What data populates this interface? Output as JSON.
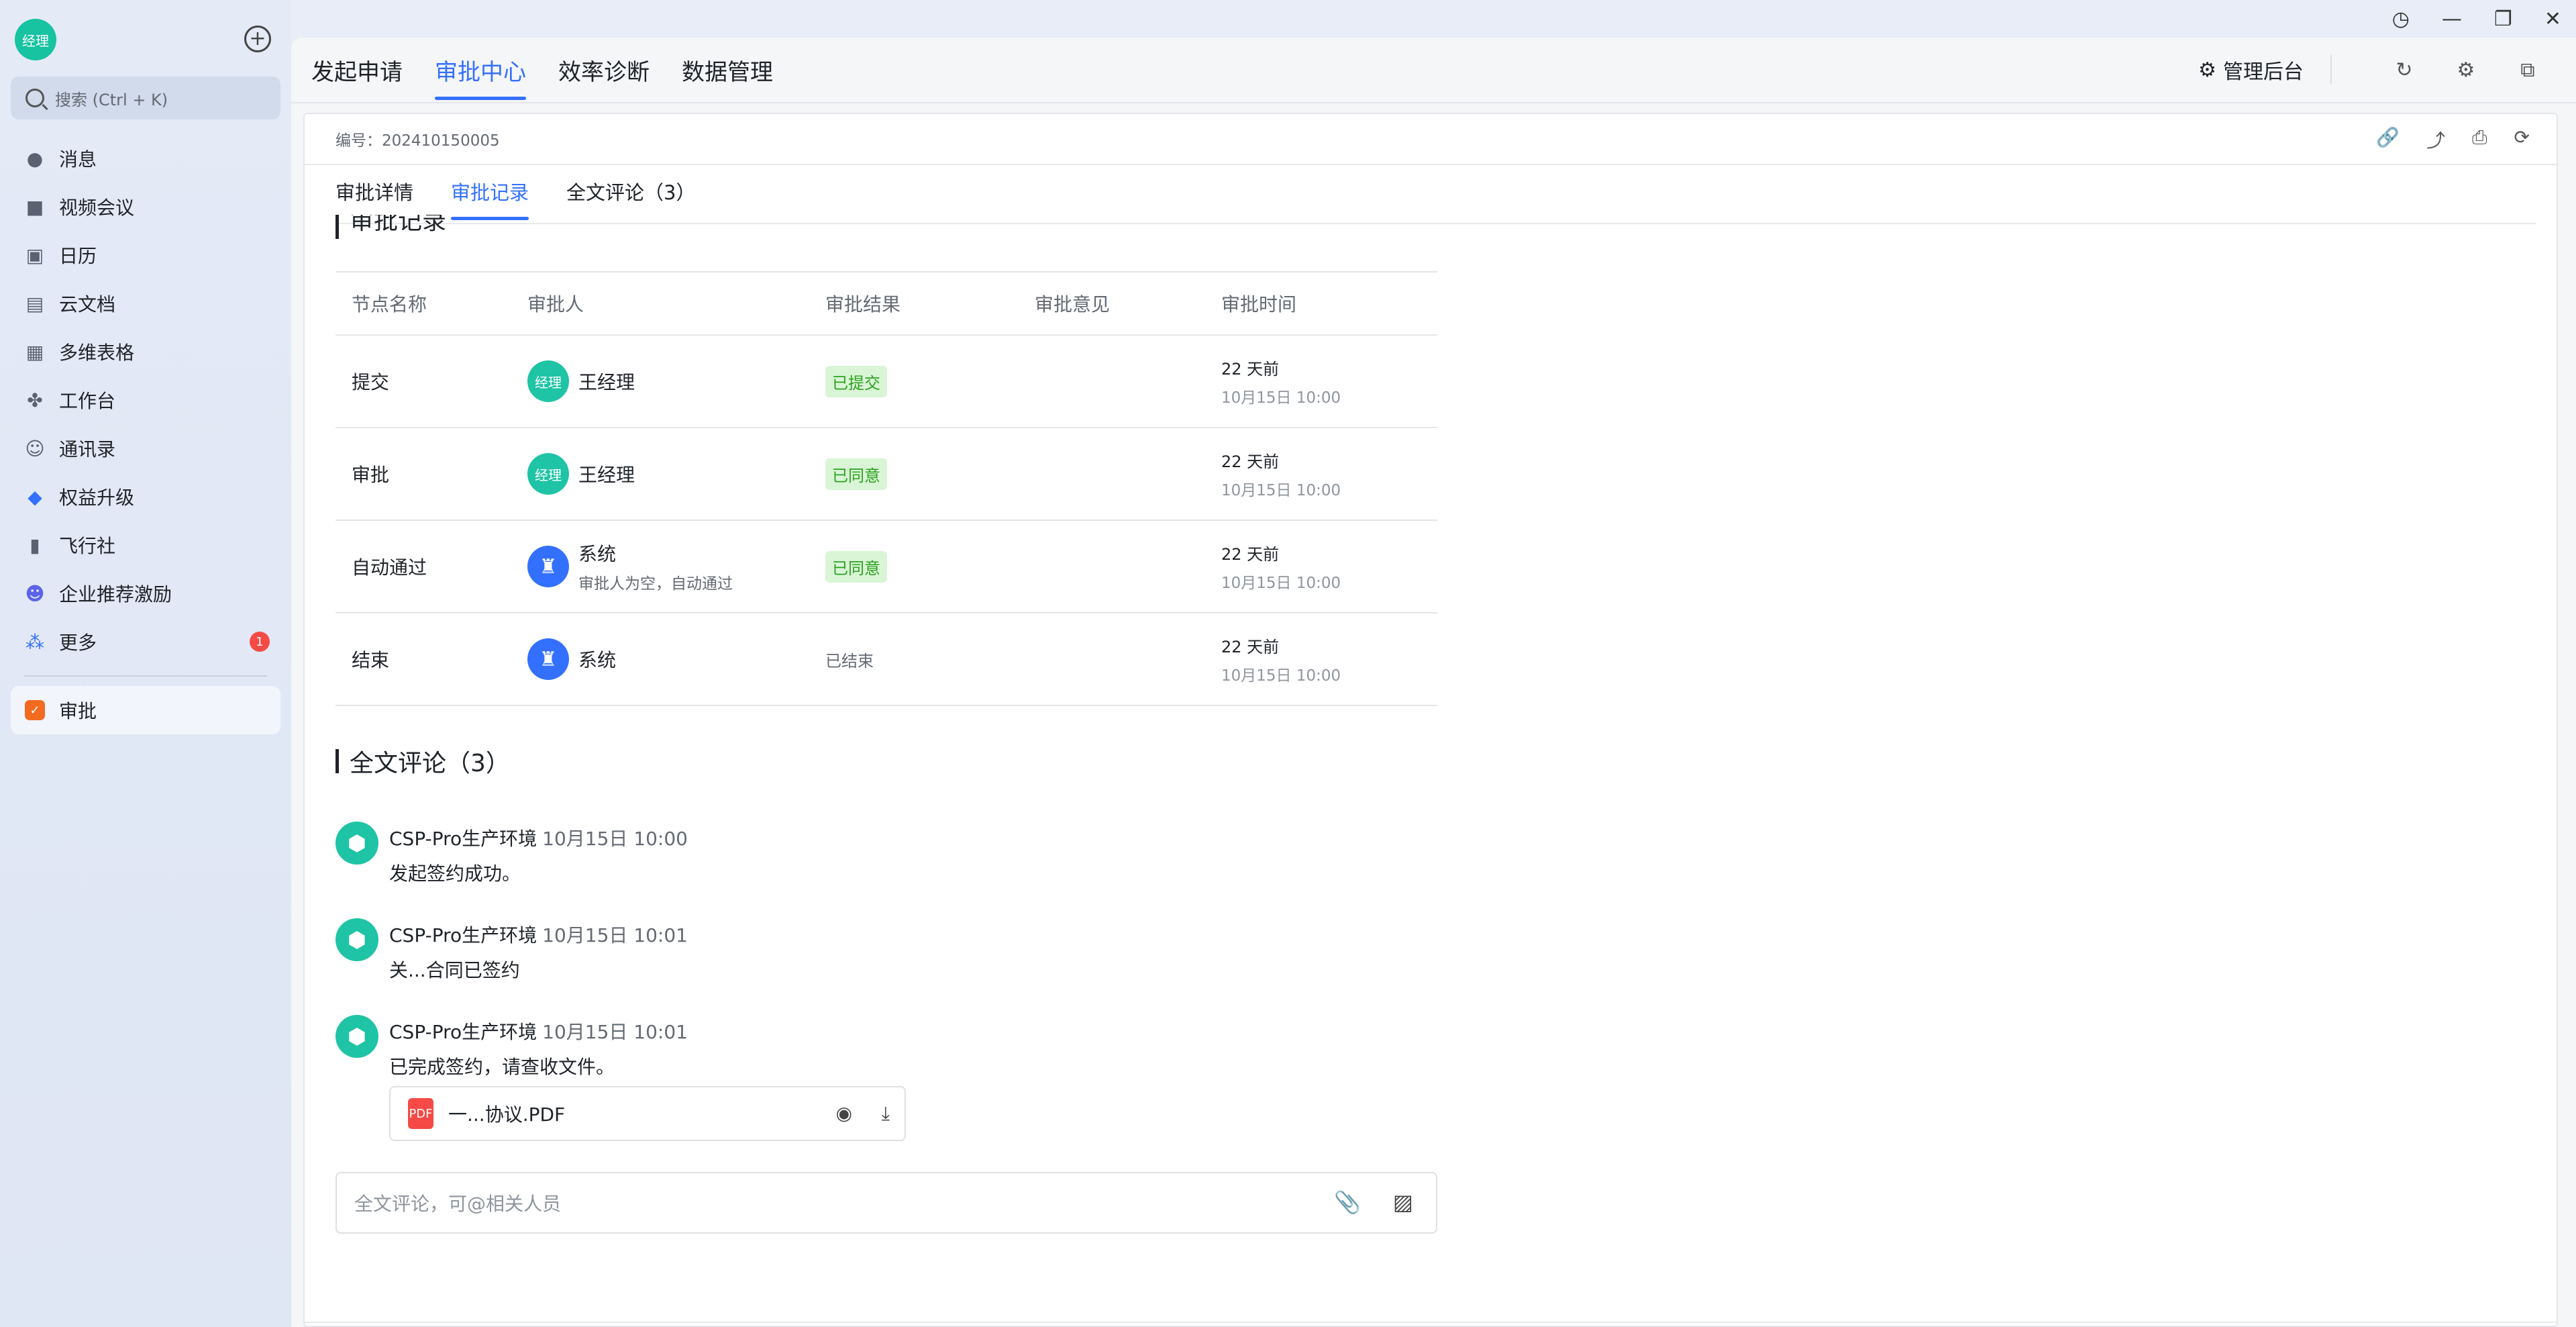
{
  "sidebar": {
    "avatar_text": "经理",
    "search_placeholder": "搜索 (Ctrl + K)",
    "items": [
      {
        "label": "消息",
        "icon": "message-icon"
      },
      {
        "label": "视频会议",
        "icon": "video-icon"
      },
      {
        "label": "日历",
        "icon": "calendar-icon"
      },
      {
        "label": "云文档",
        "icon": "cloud-doc-icon"
      },
      {
        "label": "多维表格",
        "icon": "table-icon"
      },
      {
        "label": "工作台",
        "icon": "workspace-icon"
      },
      {
        "label": "通讯录",
        "icon": "contacts-icon"
      },
      {
        "label": "权益升级",
        "icon": "diamond-icon"
      },
      {
        "label": "飞行社",
        "icon": "book-icon"
      },
      {
        "label": "企业推荐激励",
        "icon": "referral-icon"
      },
      {
        "label": "更多",
        "icon": "more-apps-icon",
        "badge": "1"
      }
    ],
    "pinned": {
      "label": "审批",
      "icon": "approval-icon"
    }
  },
  "topbar": {
    "tabs": [
      "发起申请",
      "审批中心",
      "效率诊断",
      "数据管理"
    ],
    "active_tab": "审批中心",
    "admin_label": "管理后台"
  },
  "detail": {
    "number_label": "编号：202410150005",
    "subtabs": [
      "审批详情",
      "审批记录",
      "全文评论（3）"
    ],
    "active_subtab": "审批记录",
    "records_title": "审批记录",
    "columns": [
      "节点名称",
      "审批人",
      "审批结果",
      "审批意见",
      "审批时间"
    ],
    "rows": [
      {
        "node": "提交",
        "approver": "王经理",
        "approver_avatar": "经理",
        "approver_sub": "",
        "result": "已提交",
        "opinion": "",
        "time_rel": "22 天前",
        "time_abs": "10月15日 10:00"
      },
      {
        "node": "审批",
        "approver": "王经理",
        "approver_avatar": "经理",
        "approver_sub": "",
        "result": "已同意",
        "opinion": "",
        "time_rel": "22 天前",
        "time_abs": "10月15日 10:00"
      },
      {
        "node": "自动通过",
        "approver": "系统",
        "approver_avatar": "",
        "approver_sub": "审批人为空，自动通过",
        "result": "已同意",
        "opinion": "",
        "time_rel": "22 天前",
        "time_abs": "10月15日 10:00"
      },
      {
        "node": "结束",
        "approver": "系统",
        "approver_avatar": "",
        "approver_sub": "",
        "result": "已结束",
        "opinion": "",
        "time_rel": "22 天前",
        "time_abs": "10月15日 10:00"
      }
    ],
    "comments_title": "全文评论（3）",
    "comments": [
      {
        "author": "CSP-Pro生产环境",
        "time": "10月15日 10:00",
        "text": "发起签约成功。"
      },
      {
        "author": "CSP-Pro生产环境",
        "time": "10月15日 10:01",
        "text": "关...合同已签约"
      },
      {
        "author": "CSP-Pro生产环境",
        "time": "10月15日 10:01",
        "text": "已完成签约，请查收文件。",
        "file": "一...协议.PDF"
      }
    ],
    "comment_placeholder": "全文评论，可@相关人员"
  },
  "colors": {
    "accent": "#3370ff",
    "teal": "#1ec4a5",
    "success_bg": "#d9f5d6",
    "success_text": "#2ea121",
    "badge": "#f54a45",
    "approval_icon": "#f26b21"
  }
}
